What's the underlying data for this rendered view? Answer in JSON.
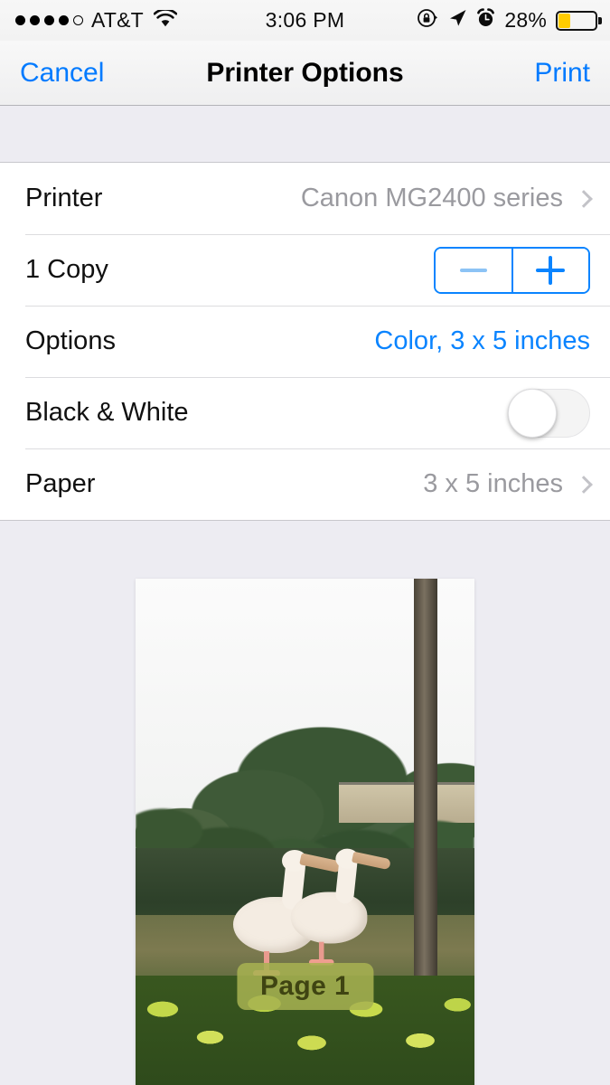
{
  "status_bar": {
    "signal_dots_filled": 4,
    "signal_dots_total": 5,
    "carrier": "AT&T",
    "wifi_icon": "wifi-icon",
    "time": "3:06 PM",
    "orientation_lock_icon": "rotation-lock-icon",
    "location_icon": "location-arrow-icon",
    "alarm_icon": "alarm-clock-icon",
    "battery_percent": "28%",
    "battery_level": 28,
    "battery_color": "#ffcc00"
  },
  "nav": {
    "cancel_label": "Cancel",
    "title": "Printer Options",
    "print_label": "Print",
    "tint_color": "#007aff"
  },
  "table": {
    "rows": [
      {
        "label": "Printer",
        "value": "Canon MG2400 series",
        "value_style": "gray",
        "accessory": "chevron-right-icon"
      },
      {
        "label": "1 Copy",
        "value": "",
        "value_style": "stepper",
        "accessory": "stepper",
        "minus_label": "−",
        "plus_label": "+",
        "minus_enabled": false,
        "plus_enabled": true
      },
      {
        "label": "Options",
        "value": "Color, 3 x 5 inches",
        "value_style": "blue",
        "accessory": "none"
      },
      {
        "label": "Black & White",
        "value": "",
        "value_style": "toggle",
        "accessory": "toggle",
        "toggle_on": false
      },
      {
        "label": "Paper",
        "value": "3 x 5 inches",
        "value_style": "gray",
        "accessory": "chevron-right-icon"
      }
    ]
  },
  "preview": {
    "page_badge": "Page 1",
    "image_description": "two pelicans standing on a grassy lake bank with trees and a palm trunk",
    "background_color": "#edecf2"
  }
}
